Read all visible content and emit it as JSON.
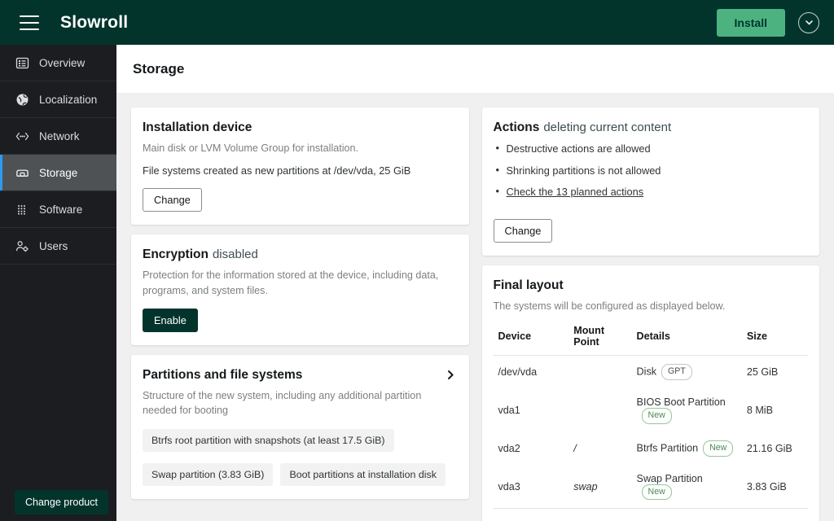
{
  "masthead": {
    "brand": "Slowroll",
    "menu_icon": "hamburger-icon",
    "install_label": "Install",
    "chevron_icon": "chevron-down-circle-icon"
  },
  "sidebar": {
    "items": [
      {
        "label": "Overview",
        "icon": "list-panel-icon",
        "active": false
      },
      {
        "label": "Localization",
        "icon": "globe-icon",
        "active": false
      },
      {
        "label": "Network",
        "icon": "network-icon",
        "active": false
      },
      {
        "label": "Storage",
        "icon": "hard-drive-icon",
        "active": true
      },
      {
        "label": "Software",
        "icon": "grid-dots-icon",
        "active": false
      },
      {
        "label": "Users",
        "icon": "user-gear-icon",
        "active": false
      }
    ],
    "change_product_label": "Change product"
  },
  "page": {
    "title": "Storage"
  },
  "installation_device": {
    "title": "Installation device",
    "description": "Main disk or LVM Volume Group for installation.",
    "detail": "File systems created as new partitions at /dev/vda, 25 GiB",
    "change_label": "Change"
  },
  "encryption": {
    "title": "Encryption",
    "status": "disabled",
    "description": "Protection for the information stored at the device, including data, programs, and system files.",
    "enable_label": "Enable"
  },
  "partitions": {
    "title": "Partitions and file systems",
    "description": "Structure of the new system, including any additional partition needed for booting",
    "expand_icon": "chevron-right-icon",
    "chips": [
      "Btrfs root partition with snapshots (at least 17.5 GiB)",
      "Swap partition (3.83 GiB)",
      "Boot partitions at installation disk"
    ]
  },
  "actions": {
    "title": "Actions",
    "status": "deleting current content",
    "bullets": [
      {
        "text": "Destructive actions are allowed",
        "link": false
      },
      {
        "text": "Shrinking partitions is not allowed",
        "link": false
      },
      {
        "text": "Check the 13 planned actions",
        "link": true
      }
    ],
    "change_label": "Change"
  },
  "final_layout": {
    "title": "Final layout",
    "description": "The systems will be configured as displayed below.",
    "columns": [
      "Device",
      "Mount Point",
      "Details",
      "Size"
    ],
    "rows": [
      {
        "device": "/dev/vda",
        "indent": 0,
        "mount": "",
        "details": "Disk",
        "badge": "GPT",
        "badge_type": "gray",
        "size": "25 GiB"
      },
      {
        "device": "vda1",
        "indent": 1,
        "mount": "",
        "details": "BIOS Boot Partition",
        "badge": "New",
        "badge_type": "green",
        "size": "8 MiB"
      },
      {
        "device": "vda2",
        "indent": 1,
        "mount": "/",
        "details": "Btrfs Partition",
        "badge": "New",
        "badge_type": "green",
        "size": "21.16 GiB"
      },
      {
        "device": "vda3",
        "indent": 1,
        "mount": "swap",
        "details": "Swap Partition",
        "badge": "New",
        "badge_type": "green",
        "size": "3.83 GiB"
      }
    ]
  },
  "colors": {
    "masthead_bg": "#02342c",
    "install_btn": "#4cb380",
    "sidebar_bg": "#1b1d21",
    "sidebar_active_bg": "#4f5255",
    "sidebar_accent": "#2b9af3",
    "content_bg": "#f0f0f0",
    "badge_green": "#4a8a53"
  }
}
